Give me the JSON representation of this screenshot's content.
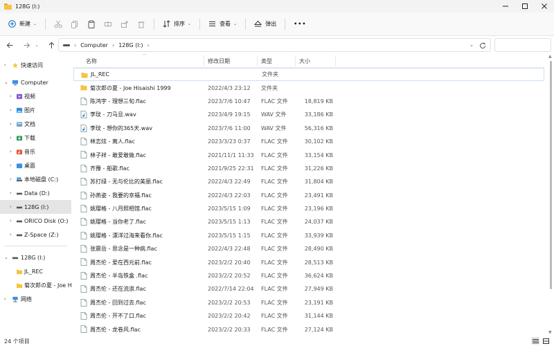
{
  "window": {
    "title": "128G (I:)"
  },
  "toolbar": {
    "new_label": "新建",
    "sort_label": "排序",
    "view_label": "查看",
    "eject_label": "弹出",
    "more_label": "•••"
  },
  "address": {
    "crumbs": [
      "Computer",
      "128G (I:)"
    ]
  },
  "search": {
    "placeholder": ""
  },
  "sidebar": {
    "quick_access": "快速访问",
    "computer": "Computer",
    "items": [
      "视频",
      "图片",
      "文档",
      "下载",
      "音乐",
      "桌面",
      "本地磁盘 (C:)",
      "Data (D:)",
      "128G (I:)",
      "ORICO Disk (O:)",
      "Z-Space (Z:)"
    ],
    "drive": "128G (I:)",
    "drive_children": [
      "JL_REC",
      "菊次郎の夏 - Joe Hisaishi 1999"
    ],
    "network": "网络"
  },
  "columns": {
    "name": "名称",
    "date": "修改日期",
    "type": "类型",
    "size": "大小"
  },
  "files": [
    {
      "name": "JL_REC",
      "date": "",
      "type": "文件夹",
      "size": "",
      "kind": "folder"
    },
    {
      "name": "菊次郎の夏 - Joe Hisaishi 1999",
      "date": "2022/4/3 23:12",
      "type": "文件夹",
      "size": "",
      "kind": "folder"
    },
    {
      "name": "陈鸿宇 - 理想三旬.flac",
      "date": "2023/7/6 10:47",
      "type": "FLAC 文件",
      "size": "18,819 KB",
      "kind": "file"
    },
    {
      "name": "李玟 - 刀马旦.wav",
      "date": "2023/4/9 19:15",
      "type": "WAV 文件",
      "size": "33,186 KB",
      "kind": "wav"
    },
    {
      "name": "李玟 - 想你的365天.wav",
      "date": "2023/7/6 11:00",
      "type": "WAV 文件",
      "size": "56,316 KB",
      "kind": "wav"
    },
    {
      "name": "林志炫 - 离人.flac",
      "date": "2023/3/23 0:37",
      "type": "FLAC 文件",
      "size": "30,102 KB",
      "kind": "file"
    },
    {
      "name": "林子祥 - 敢爱敢做.flac",
      "date": "2021/11/1 11:33",
      "type": "FLAC 文件",
      "size": "33,154 KB",
      "kind": "file"
    },
    {
      "name": "齐豫 - 船歌.flac",
      "date": "2021/9/25 22:31",
      "type": "FLAC 文件",
      "size": "31,226 KB",
      "kind": "file"
    },
    {
      "name": "苏打绿 - 无与伦比的美丽.flac",
      "date": "2022/4/3 22:49",
      "type": "FLAC 文件",
      "size": "31,804 KB",
      "kind": "file"
    },
    {
      "name": "孙燕姿 - 我要的幸福.flac",
      "date": "2022/4/3 22:03",
      "type": "FLAC 文件",
      "size": "23,491 KB",
      "kind": "file"
    },
    {
      "name": "姚璎格 - 八月照相馆.flac",
      "date": "2023/5/15 1:09",
      "type": "FLAC 文件",
      "size": "23,196 KB",
      "kind": "file"
    },
    {
      "name": "姚璎格 - 当你老了.flac",
      "date": "2023/5/15 1:13",
      "type": "FLAC 文件",
      "size": "24,037 KB",
      "kind": "file"
    },
    {
      "name": "姚璎格 - 漂洋过海来看你.flac",
      "date": "2023/5/15 1:15",
      "type": "FLAC 文件",
      "size": "33,939 KB",
      "kind": "file"
    },
    {
      "name": "张震岳 - 思念是一种病.flac",
      "date": "2022/4/3 22:48",
      "type": "FLAC 文件",
      "size": "28,490 KB",
      "kind": "file"
    },
    {
      "name": "周杰伦 - 爱在西元前.flac",
      "date": "2023/2/2 20:40",
      "type": "FLAC 文件",
      "size": "28,513 KB",
      "kind": "file"
    },
    {
      "name": "周杰伦 - 半岛铁盒 .flac",
      "date": "2023/2/2 20:52",
      "type": "FLAC 文件",
      "size": "36,624 KB",
      "kind": "file"
    },
    {
      "name": "周杰伦 - 还在流浪.flac",
      "date": "2022/7/14 22:04",
      "type": "FLAC 文件",
      "size": "27,949 KB",
      "kind": "file"
    },
    {
      "name": "周杰伦 - 回到过去.flac",
      "date": "2023/2/2 20:53",
      "type": "FLAC 文件",
      "size": "23,191 KB",
      "kind": "file"
    },
    {
      "name": "周杰伦 - 开不了口.flac",
      "date": "2023/2/2 20:42",
      "type": "FLAC 文件",
      "size": "31,144 KB",
      "kind": "file"
    },
    {
      "name": "周杰伦 - 龙卷风.flac",
      "date": "2023/2/2 20:33",
      "type": "FLAC 文件",
      "size": "27,124 KB",
      "kind": "file"
    }
  ],
  "status": {
    "count_text": "24 个项目"
  },
  "colors": {
    "folder": "#f6c342",
    "accent": "#0067c0",
    "selected": "#e5e5e5"
  }
}
